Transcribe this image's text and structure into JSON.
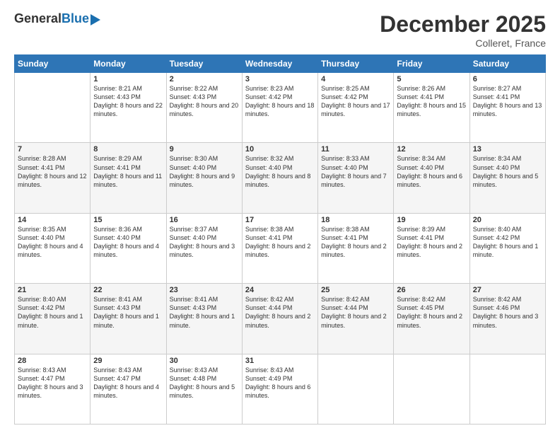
{
  "logo": {
    "general": "General",
    "blue": "Blue"
  },
  "header": {
    "month": "December 2025",
    "location": "Colleret, France"
  },
  "days": [
    "Sunday",
    "Monday",
    "Tuesday",
    "Wednesday",
    "Thursday",
    "Friday",
    "Saturday"
  ],
  "weeks": [
    [
      {
        "num": "",
        "sunrise": "",
        "sunset": "",
        "daylight": ""
      },
      {
        "num": "1",
        "sunrise": "Sunrise: 8:21 AM",
        "sunset": "Sunset: 4:43 PM",
        "daylight": "Daylight: 8 hours and 22 minutes."
      },
      {
        "num": "2",
        "sunrise": "Sunrise: 8:22 AM",
        "sunset": "Sunset: 4:43 PM",
        "daylight": "Daylight: 8 hours and 20 minutes."
      },
      {
        "num": "3",
        "sunrise": "Sunrise: 8:23 AM",
        "sunset": "Sunset: 4:42 PM",
        "daylight": "Daylight: 8 hours and 18 minutes."
      },
      {
        "num": "4",
        "sunrise": "Sunrise: 8:25 AM",
        "sunset": "Sunset: 4:42 PM",
        "daylight": "Daylight: 8 hours and 17 minutes."
      },
      {
        "num": "5",
        "sunrise": "Sunrise: 8:26 AM",
        "sunset": "Sunset: 4:41 PM",
        "daylight": "Daylight: 8 hours and 15 minutes."
      },
      {
        "num": "6",
        "sunrise": "Sunrise: 8:27 AM",
        "sunset": "Sunset: 4:41 PM",
        "daylight": "Daylight: 8 hours and 13 minutes."
      }
    ],
    [
      {
        "num": "7",
        "sunrise": "Sunrise: 8:28 AM",
        "sunset": "Sunset: 4:41 PM",
        "daylight": "Daylight: 8 hours and 12 minutes."
      },
      {
        "num": "8",
        "sunrise": "Sunrise: 8:29 AM",
        "sunset": "Sunset: 4:41 PM",
        "daylight": "Daylight: 8 hours and 11 minutes."
      },
      {
        "num": "9",
        "sunrise": "Sunrise: 8:30 AM",
        "sunset": "Sunset: 4:40 PM",
        "daylight": "Daylight: 8 hours and 9 minutes."
      },
      {
        "num": "10",
        "sunrise": "Sunrise: 8:32 AM",
        "sunset": "Sunset: 4:40 PM",
        "daylight": "Daylight: 8 hours and 8 minutes."
      },
      {
        "num": "11",
        "sunrise": "Sunrise: 8:33 AM",
        "sunset": "Sunset: 4:40 PM",
        "daylight": "Daylight: 8 hours and 7 minutes."
      },
      {
        "num": "12",
        "sunrise": "Sunrise: 8:34 AM",
        "sunset": "Sunset: 4:40 PM",
        "daylight": "Daylight: 8 hours and 6 minutes."
      },
      {
        "num": "13",
        "sunrise": "Sunrise: 8:34 AM",
        "sunset": "Sunset: 4:40 PM",
        "daylight": "Daylight: 8 hours and 5 minutes."
      }
    ],
    [
      {
        "num": "14",
        "sunrise": "Sunrise: 8:35 AM",
        "sunset": "Sunset: 4:40 PM",
        "daylight": "Daylight: 8 hours and 4 minutes."
      },
      {
        "num": "15",
        "sunrise": "Sunrise: 8:36 AM",
        "sunset": "Sunset: 4:40 PM",
        "daylight": "Daylight: 8 hours and 4 minutes."
      },
      {
        "num": "16",
        "sunrise": "Sunrise: 8:37 AM",
        "sunset": "Sunset: 4:40 PM",
        "daylight": "Daylight: 8 hours and 3 minutes."
      },
      {
        "num": "17",
        "sunrise": "Sunrise: 8:38 AM",
        "sunset": "Sunset: 4:41 PM",
        "daylight": "Daylight: 8 hours and 2 minutes."
      },
      {
        "num": "18",
        "sunrise": "Sunrise: 8:38 AM",
        "sunset": "Sunset: 4:41 PM",
        "daylight": "Daylight: 8 hours and 2 minutes."
      },
      {
        "num": "19",
        "sunrise": "Sunrise: 8:39 AM",
        "sunset": "Sunset: 4:41 PM",
        "daylight": "Daylight: 8 hours and 2 minutes."
      },
      {
        "num": "20",
        "sunrise": "Sunrise: 8:40 AM",
        "sunset": "Sunset: 4:42 PM",
        "daylight": "Daylight: 8 hours and 1 minute."
      }
    ],
    [
      {
        "num": "21",
        "sunrise": "Sunrise: 8:40 AM",
        "sunset": "Sunset: 4:42 PM",
        "daylight": "Daylight: 8 hours and 1 minute."
      },
      {
        "num": "22",
        "sunrise": "Sunrise: 8:41 AM",
        "sunset": "Sunset: 4:43 PM",
        "daylight": "Daylight: 8 hours and 1 minute."
      },
      {
        "num": "23",
        "sunrise": "Sunrise: 8:41 AM",
        "sunset": "Sunset: 4:43 PM",
        "daylight": "Daylight: 8 hours and 1 minute."
      },
      {
        "num": "24",
        "sunrise": "Sunrise: 8:42 AM",
        "sunset": "Sunset: 4:44 PM",
        "daylight": "Daylight: 8 hours and 2 minutes."
      },
      {
        "num": "25",
        "sunrise": "Sunrise: 8:42 AM",
        "sunset": "Sunset: 4:44 PM",
        "daylight": "Daylight: 8 hours and 2 minutes."
      },
      {
        "num": "26",
        "sunrise": "Sunrise: 8:42 AM",
        "sunset": "Sunset: 4:45 PM",
        "daylight": "Daylight: 8 hours and 2 minutes."
      },
      {
        "num": "27",
        "sunrise": "Sunrise: 8:42 AM",
        "sunset": "Sunset: 4:46 PM",
        "daylight": "Daylight: 8 hours and 3 minutes."
      }
    ],
    [
      {
        "num": "28",
        "sunrise": "Sunrise: 8:43 AM",
        "sunset": "Sunset: 4:47 PM",
        "daylight": "Daylight: 8 hours and 3 minutes."
      },
      {
        "num": "29",
        "sunrise": "Sunrise: 8:43 AM",
        "sunset": "Sunset: 4:47 PM",
        "daylight": "Daylight: 8 hours and 4 minutes."
      },
      {
        "num": "30",
        "sunrise": "Sunrise: 8:43 AM",
        "sunset": "Sunset: 4:48 PM",
        "daylight": "Daylight: 8 hours and 5 minutes."
      },
      {
        "num": "31",
        "sunrise": "Sunrise: 8:43 AM",
        "sunset": "Sunset: 4:49 PM",
        "daylight": "Daylight: 8 hours and 6 minutes."
      },
      {
        "num": "",
        "sunrise": "",
        "sunset": "",
        "daylight": ""
      },
      {
        "num": "",
        "sunrise": "",
        "sunset": "",
        "daylight": ""
      },
      {
        "num": "",
        "sunrise": "",
        "sunset": "",
        "daylight": ""
      }
    ]
  ]
}
